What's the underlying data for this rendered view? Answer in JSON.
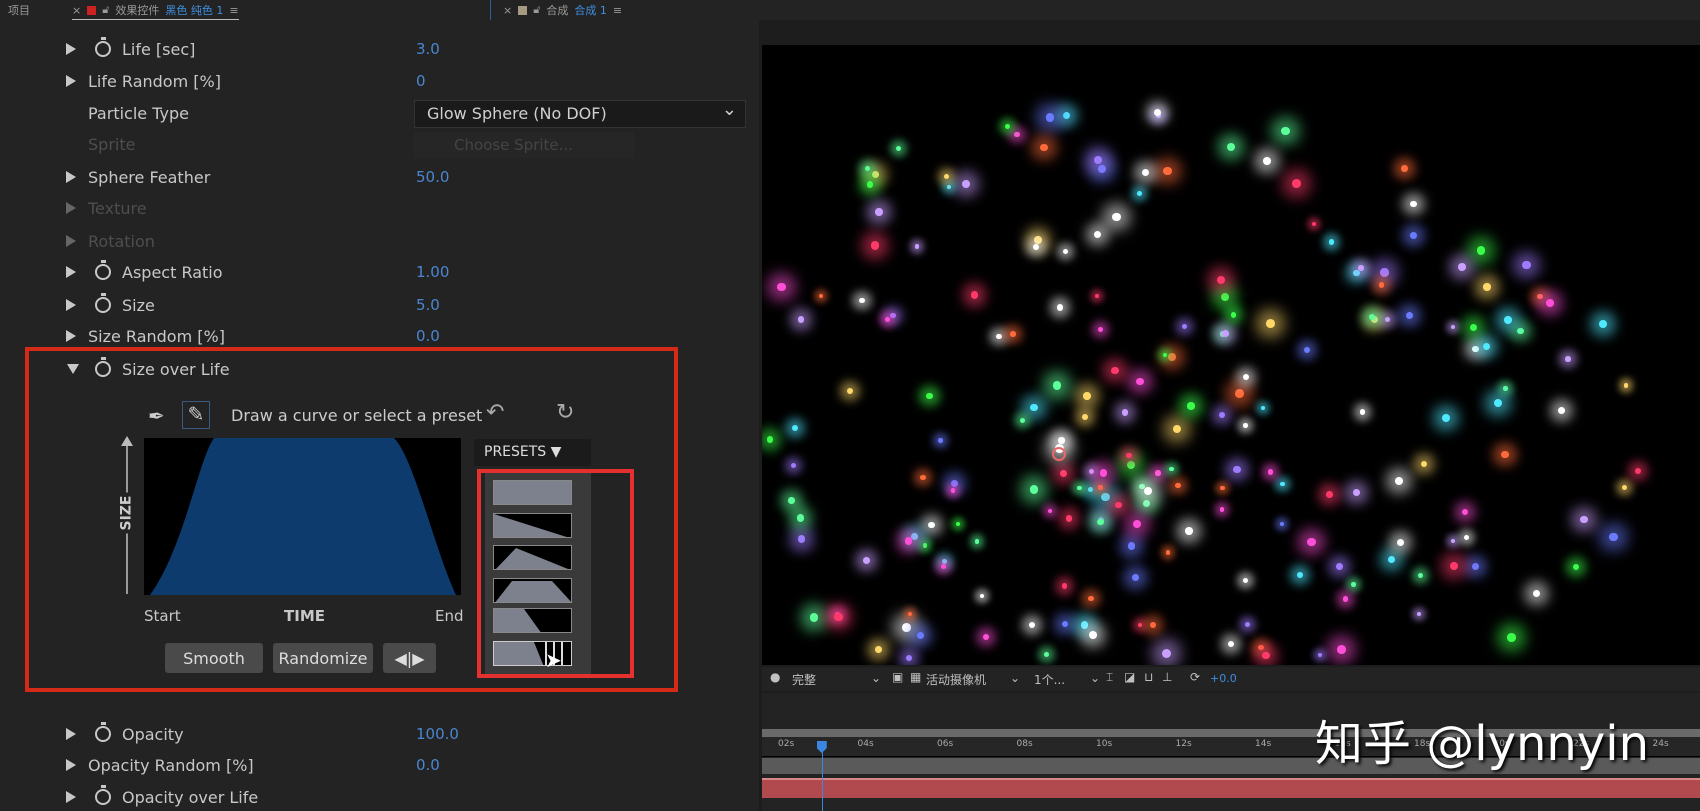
{
  "tabs": {
    "project": "项目",
    "effects_prefix": "效果控件",
    "effects_layer": "黑色 纯色 1",
    "comp_prefix": "合成",
    "comp_name": "合成 1"
  },
  "properties": [
    {
      "label": "Life [sec]",
      "value": "3.0",
      "stopwatch": true
    },
    {
      "label": "Life Random [%]",
      "value": "0"
    },
    {
      "label": "Particle Type",
      "value": "Glow Sphere (No DOF)"
    },
    {
      "label": "Sprite",
      "value": "Choose Sprite..."
    },
    {
      "label": "Sphere Feather",
      "value": "50.0"
    },
    {
      "label": "Texture"
    },
    {
      "label": "Rotation"
    },
    {
      "label": "Aspect Ratio",
      "value": "1.00",
      "stopwatch": true
    },
    {
      "label": "Size",
      "value": "5.0",
      "stopwatch": true
    },
    {
      "label": "Size Random [%]",
      "value": "0.0"
    },
    {
      "label": "Size over Life",
      "stopwatch": true
    },
    {
      "label": "Opacity",
      "value": "100.0",
      "stopwatch": true
    },
    {
      "label": "Opacity Random [%]",
      "value": "0.0"
    },
    {
      "label": "Opacity over Life",
      "stopwatch": true
    }
  ],
  "curve": {
    "hint": "Draw a curve or select a preset",
    "y_axis": "SIZE",
    "x_axis": "TIME",
    "start": "Start",
    "end": "End",
    "smooth": "Smooth",
    "randomize": "Randomize",
    "presets": "PRESETS"
  },
  "viewer_toolbar": {
    "quality": "完整",
    "camera": "活动摄像机",
    "views": "1个...",
    "exposure": "+0.0"
  },
  "timeline": {
    "ticks": [
      "02s",
      "04s",
      "06s",
      "08s",
      "10s",
      "12s",
      "14s",
      "16s",
      "18s",
      "20s",
      "22s",
      "24s"
    ],
    "playhead_seconds": 2.9
  },
  "watermark": "知乎 @lynnyin",
  "colors": {
    "accent": "#3f8fe0",
    "highlight": "#d42a18",
    "curve_fill": "#0d3b6e"
  }
}
